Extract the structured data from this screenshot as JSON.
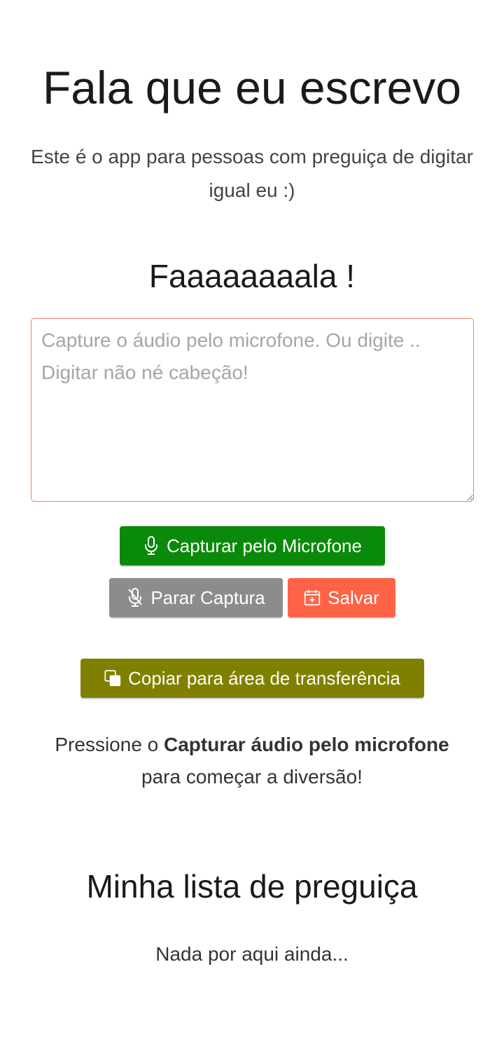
{
  "header": {
    "title": "Fala que eu escrevo",
    "subtitle": "Este é o app para pessoas com preguiça de digitar igual eu :)"
  },
  "speech": {
    "heading": "Faaaaaaaala !",
    "textarea_value": "",
    "textarea_placeholder": "Capture o áudio pelo microfone. Ou digite .. Digitar não né cabeção!"
  },
  "buttons": {
    "capture": {
      "label": "Capturar pelo Microfone",
      "icon": "microphone-icon",
      "color": "#0a8a0a"
    },
    "stop": {
      "label": "Parar Captura",
      "icon": "microphone-off-icon",
      "color": "#8c8c8c"
    },
    "save": {
      "label": "Salvar",
      "icon": "calendar-plus-icon",
      "color": "#ff6347"
    },
    "copy": {
      "label": "Copiar para área de transferência",
      "icon": "copy-icon",
      "color": "#808000"
    }
  },
  "hint": {
    "prefix": "Pressione o ",
    "bold": "Capturar áudio pelo microfone",
    "suffix": " para começar a diversão!"
  },
  "list": {
    "heading": "Minha lista de preguiça",
    "empty_text": "Nada por aqui ainda..."
  }
}
